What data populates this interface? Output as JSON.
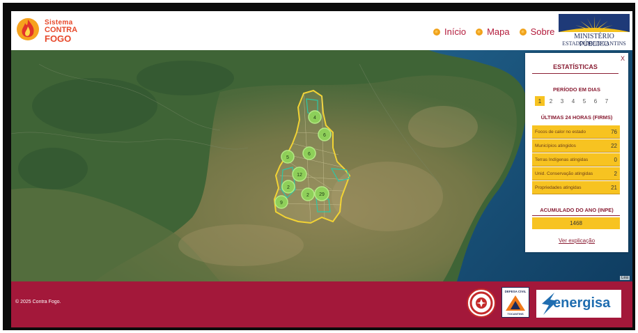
{
  "header": {
    "logo": {
      "line1": "Sistema",
      "line2": "CONTRA",
      "line3": "FOGO"
    },
    "nav": [
      {
        "label": "Início"
      },
      {
        "label": "Mapa"
      },
      {
        "label": "Sobre"
      }
    ],
    "partner_logo": {
      "line1": "MINISTÉRIO PÚBLICO",
      "line2": "ESTADO DO TOCANTINS"
    }
  },
  "map": {
    "clusters": [
      {
        "count": "4"
      },
      {
        "count": "6"
      },
      {
        "count": "5"
      },
      {
        "count": "6"
      },
      {
        "count": "12"
      },
      {
        "count": "2"
      },
      {
        "count": "2"
      },
      {
        "count": "29"
      },
      {
        "count": "9"
      }
    ],
    "attribution": "Lea",
    "colors": {
      "state_border": "#f2d334",
      "cluster": "#8fd35a",
      "protected_areas": "#2ec7a6"
    }
  },
  "stats": {
    "close_label": "X",
    "title": "ESTATÍSTICAS",
    "period_label": "PERÍODO EM DIAS",
    "days": [
      "1",
      "2",
      "3",
      "4",
      "5",
      "6",
      "7"
    ],
    "active_day": "1",
    "last24_label": "ÚLTIMAS 24 HORAS (FIRMS)",
    "rows": [
      {
        "label": "Focos de calor no estado",
        "value": "76"
      },
      {
        "label": "Municípios atingidos",
        "value": "22"
      },
      {
        "label": "Terras Indígenas atingidas",
        "value": "0"
      },
      {
        "label": "Unid. Conservação atingidas",
        "value": "2"
      },
      {
        "label": "Propriedades atingidas",
        "value": "21"
      }
    ],
    "accum_label": "ACUMULADO DO ANO (INPE)",
    "accum_value": "1468",
    "explain_link": "Ver explicação"
  },
  "footer": {
    "copyright": "© 2025 Contra Fogo.",
    "defesa": {
      "line1": "DEFESA CIVIL",
      "line2": "TOCANTINS"
    },
    "energisa": "energisa"
  }
}
